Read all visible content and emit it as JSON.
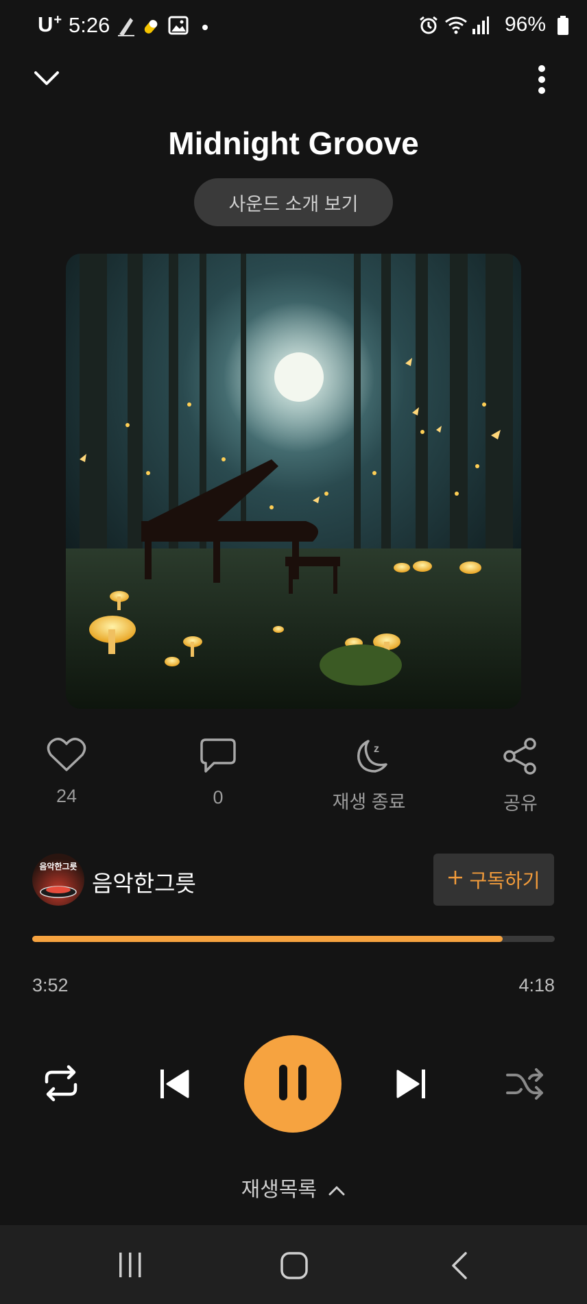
{
  "status_bar": {
    "carrier": "U",
    "carrier_sup": "+",
    "time": "5:26",
    "battery": "96%"
  },
  "header": {
    "title": "Midnight Groove",
    "sound_info_label": "사운드 소개 보기"
  },
  "actions": [
    {
      "icon": "heart-icon",
      "label": "24"
    },
    {
      "icon": "comment-icon",
      "label": "0"
    },
    {
      "icon": "sleep-timer-icon",
      "label": "재생 종료"
    },
    {
      "icon": "share-icon",
      "label": "공유"
    }
  ],
  "channel": {
    "avatar_text": "음악한그릇",
    "name": "음악한그릇",
    "subscribe_label": "구독하기"
  },
  "playback": {
    "current_time": "3:52",
    "total_time": "4:18",
    "progress": 0.9
  },
  "playlist_label": "재생목록",
  "colors": {
    "accent": "#f6a340",
    "background": "#141414"
  }
}
